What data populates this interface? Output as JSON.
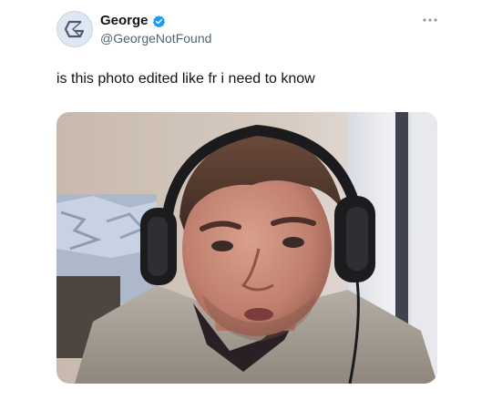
{
  "user": {
    "display_name": "George",
    "handle": "@GeorgeNotFound",
    "verified": true,
    "avatar_icon": "stylized-g-logo-icon"
  },
  "tweet": {
    "text": "is this photo edited like fr i need to know"
  },
  "colors": {
    "verified_blue": "#1d9bf0",
    "handle_gray": "#536471",
    "text": "#0f1419"
  },
  "media": {
    "type": "photo",
    "icon": "headphones-webcam-photo"
  },
  "menu": {
    "icon": "more-options-icon"
  }
}
